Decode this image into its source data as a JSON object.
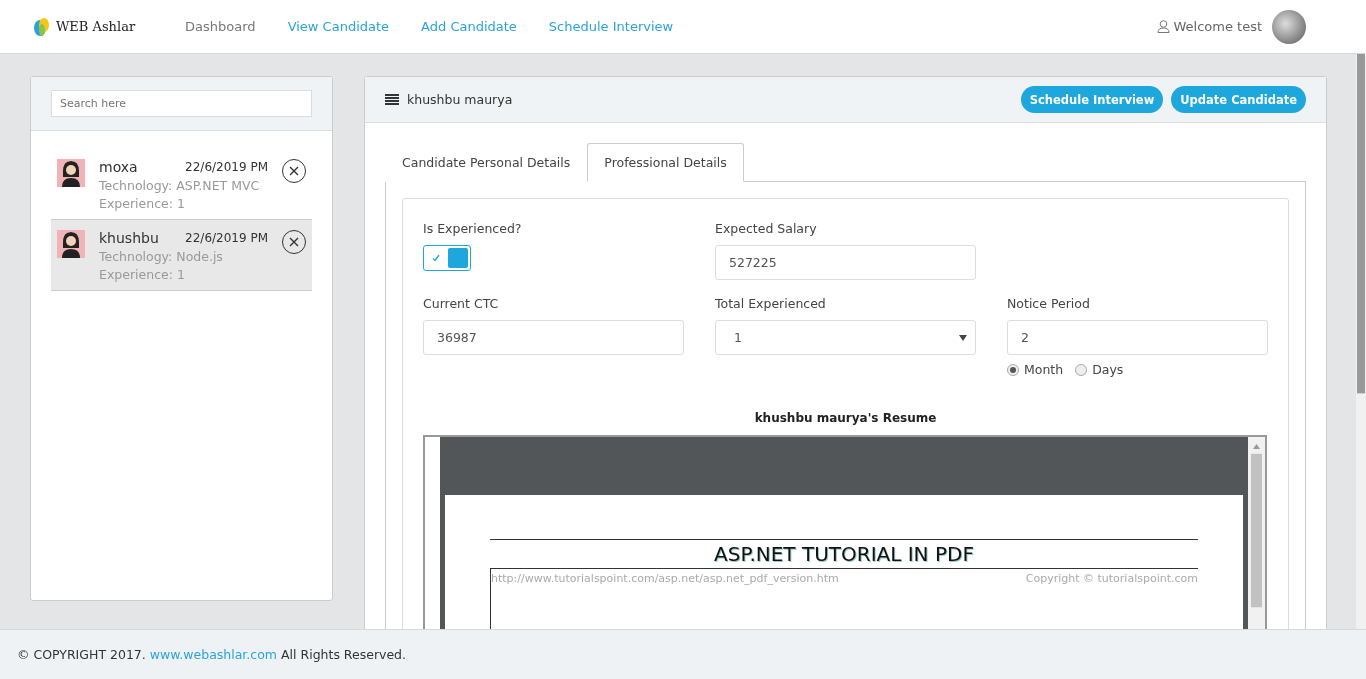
{
  "header": {
    "logo": "WEB Ashlar",
    "nav": [
      {
        "label": "Dashboard",
        "selected": true
      },
      {
        "label": "View Candidate",
        "selected": false
      },
      {
        "label": "Add Candidate",
        "selected": false
      },
      {
        "label": "Schedule Interview",
        "selected": false
      }
    ],
    "welcome": "Welcome test"
  },
  "sidebar": {
    "search": {
      "placeholder": "Search here"
    },
    "candidates": [
      {
        "name": "moxa",
        "date": "22/6/2019 PM",
        "technology": "Technology: ASP.NET MVC",
        "experience": "Experience: 1",
        "selected": false
      },
      {
        "name": "khushbu",
        "date": "22/6/2019 PM",
        "technology": "Technology: Node.js",
        "experience": "Experience: 1",
        "selected": true
      }
    ]
  },
  "panel": {
    "title": "khushbu maurya",
    "buttons": [
      "Schedule Interview",
      "Update Candidate"
    ],
    "tabs": [
      {
        "label": "Candidate Personal Details",
        "selected": false
      },
      {
        "label": "Professional Details",
        "selected": true
      }
    ],
    "form": {
      "is_experienced": {
        "label": "Is Experienced?",
        "checked": true
      },
      "expected_salary": {
        "label": "Expected Salary",
        "value": "527225"
      },
      "current_ctc": {
        "label": "Current CTC",
        "value": "36987"
      },
      "total_experienced": {
        "label": "Total Experienced",
        "value": "1"
      },
      "notice_period": {
        "label": "Notice Period",
        "value": "2",
        "units": [
          {
            "label": "Month",
            "selected": true
          },
          {
            "label": "Days",
            "selected": false
          }
        ]
      }
    },
    "resume": {
      "title": "khushbu maurya's Resume",
      "doc_title": "ASP.NET TUTORIAL IN PDF",
      "doc_url": "http://www.tutorialspoint.com/asp.net/asp.net_pdf_version.htm",
      "doc_copyright": "Copyright © tutorialspoint.com"
    }
  },
  "footer": {
    "prefix": "© COPYRIGHT 2017.",
    "link": "www.webashlar.com",
    "suffix": "All Rights Reserved."
  }
}
